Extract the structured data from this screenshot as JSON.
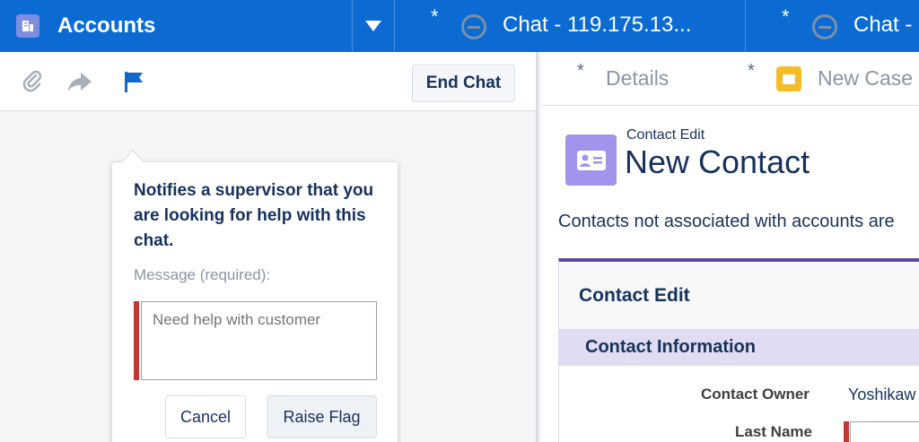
{
  "tabs": {
    "accounts_label": "Accounts",
    "chat1_label": "Chat - 119.175.13...",
    "chat2_label": "Chat -"
  },
  "toolbar": {
    "end_chat_label": "End Chat"
  },
  "flag_popover": {
    "title": "Notifies a supervisor that you are looking for help with this chat.",
    "message_label": "Message (required):",
    "message_placeholder": "Need help with customer",
    "cancel_label": "Cancel",
    "raise_label": "Raise Flag"
  },
  "subtabs": {
    "details_label": "Details",
    "new_case_label": "New Case"
  },
  "contact_edit": {
    "small_title": "Contact Edit",
    "big_title": "New Contact",
    "note": "Contacts not associated with accounts are",
    "card_title": "Contact Edit",
    "section_title": "Contact Information",
    "owner_label": "Contact Owner",
    "owner_value": "Yoshikaw",
    "last_name_label": "Last Name"
  },
  "colors": {
    "brand_blue": "#0b6bd3",
    "required_red": "#c23934",
    "flag_blue": "#1069c8",
    "contact_purple": "#a094ed",
    "case_yellow": "#f4bc25"
  }
}
